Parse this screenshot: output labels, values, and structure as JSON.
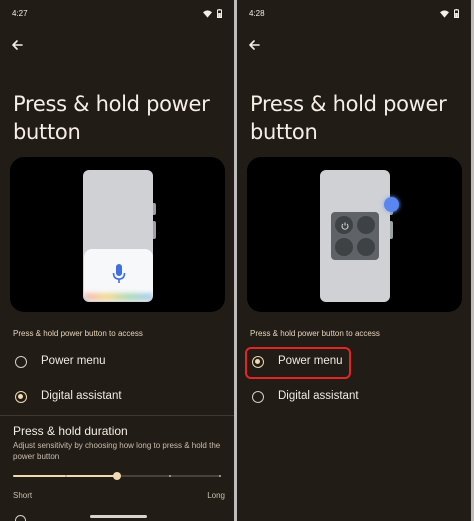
{
  "colors": {
    "background": "#211c16",
    "accent": "#f0d8b3",
    "highlight": "#e42525"
  },
  "left": {
    "status": {
      "time": "4:27"
    },
    "title": "Press & hold power button",
    "preview": "assistant",
    "section_label": "Press & hold power button to access",
    "options": [
      {
        "label": "Power menu",
        "selected": false
      },
      {
        "label": "Digital assistant",
        "selected": true
      }
    ],
    "duration": {
      "title": "Press & hold duration",
      "description": "Adjust sensitivity by choosing how long to press & hold the power button",
      "slider_value": 0.5,
      "min_label": "Short",
      "max_label": "Long"
    }
  },
  "right": {
    "status": {
      "time": "4:28"
    },
    "title": "Press & hold power button",
    "preview": "power-menu",
    "section_label": "Press & hold power button to access",
    "options": [
      {
        "label": "Power menu",
        "selected": true,
        "highlighted": true
      },
      {
        "label": "Digital assistant",
        "selected": false
      }
    ]
  }
}
